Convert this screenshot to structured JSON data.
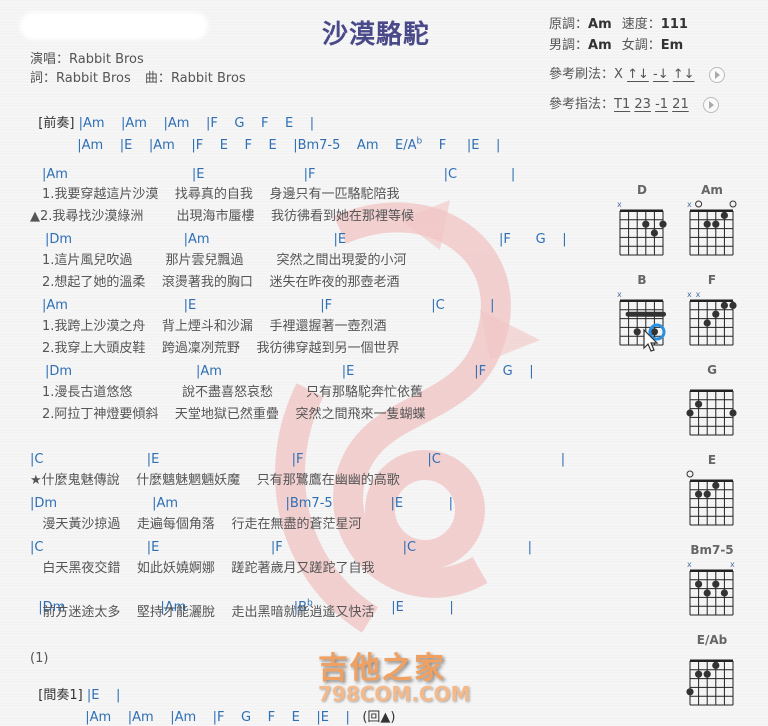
{
  "header": {
    "title": "沙漠駱駝",
    "singer_label": "演唱：",
    "singer": "Rabbit Bros",
    "lyricist_label": "詞：",
    "lyricist": "Rabbit Bros",
    "composer_label": "曲：",
    "composer": "Rabbit Bros"
  },
  "info": {
    "original_key_label": "原調：",
    "original_key": "Am",
    "tempo_label": "速度：",
    "tempo": "111",
    "male_key_label": "男調：",
    "male_key": "Am",
    "female_key_label": "女調：",
    "female_key": "Em",
    "strum_label": "參考刷法：",
    "strum_pattern": [
      "X",
      "↑↓",
      "-↓",
      "↑↓"
    ],
    "finger_label": "參考指法：",
    "finger_pattern": [
      "T1",
      "23",
      "-1",
      "21"
    ]
  },
  "sheet": {
    "intro_label": "[前奏]",
    "intro_line1": "|Am    |Am    |Am    |F    G    F    E    |",
    "intro_line2a": "|Am    |E    |Am    |F    E    F    E    |Bm7-5    Am    E/A",
    "intro_line2_sup": "b",
    "intro_line2b": "    F     |E    |",
    "verse": [
      {
        "chords": "|Am                              |E                        |F                               |C             |"
      },
      {
        "lyric": "1.我要穿越這片沙漠    找尋真的自我    身邊只有一匹駱駝陪我"
      },
      {
        "lyric": "▲2.我尋找沙漠綠洲        出現海市蜃樓    我彷彿看到她在那裡等候"
      },
      {
        "chords": "|Dm                           |Am                              |E                                     |F      G    |"
      },
      {
        "lyric": "1.這片風兒吹過        那片雲兒飄過        突然之間出現愛的小河"
      },
      {
        "lyric": "2.想起了她的溫柔    滾燙著我的胸口    迷失在昨夜的那壺老酒"
      },
      {
        "chords": "|Am                            |E                              |F                        |C           |"
      },
      {
        "lyric": "1.我跨上沙漠之舟    背上煙斗和沙漏    手裡還握著一壺烈酒"
      },
      {
        "lyric": "2.我穿上大頭皮鞋    跨過凜冽荒野    我彷彿穿越到另一個世界"
      },
      {
        "chords": "|Dm                              |Am                             |E                             |F    G    |"
      },
      {
        "lyric": "1.漫長古道悠悠            說不盡喜怒哀愁        只有那駱駝奔忙依舊"
      },
      {
        "lyric": "2.阿拉丁神燈要傾斜    天堂地獄已然重疊    突然之間飛來一隻蝴蝶"
      }
    ],
    "chorus": [
      {
        "chords": "|C                         |E                                |F                              |C                             |"
      },
      {
        "lyric": "★什麼鬼魅傳說    什麼魑魅魍魎妖魔    只有那鷺鷹在幽幽的高歌"
      },
      {
        "chords": "|Dm                       |Am                          |Bm7-5              |E           |"
      },
      {
        "lyric": "   漫天黃沙掠過    走遍每個角落    行走在無盡的蒼茫星河"
      },
      {
        "chords": "|C                         |E                           |F                             |C                           |"
      },
      {
        "lyric": "   白天黑夜交錯    如此妖嬈婀娜    蹉跎著歲月又蹉跎了自我"
      },
      {
        "chords_a": "|Dm                       |Am                          |B",
        "sup": "b",
        "chords_b": "                   |E           |"
      },
      {
        "lyric": "   前方迷途太多    堅持才能灑脫    走出黑暗就能逍遙又快活"
      }
    ],
    "ending_marker": "(1)",
    "interlude_label": "[間奏1]",
    "interlude_line1": "|E    |",
    "interlude_line2": "|Am    |Am    |Am    |F    G    F    E    |E    |",
    "repeat_marker": "(回▲)"
  },
  "chord_diagrams": [
    {
      "name": "D"
    },
    {
      "name": "Am"
    },
    {
      "name": "B"
    },
    {
      "name": "F"
    },
    {
      "name": "G"
    },
    {
      "name": "E"
    },
    {
      "name": "Bm7-5"
    },
    {
      "name": "E/Ab"
    }
  ],
  "watermark": {
    "text": "吉他之家",
    "sub": "798COM.COM"
  },
  "colors": {
    "title": "#4a4a8a",
    "chord": "#2e6fb5",
    "lyric": "#555555",
    "watermark": "#f0a060"
  }
}
